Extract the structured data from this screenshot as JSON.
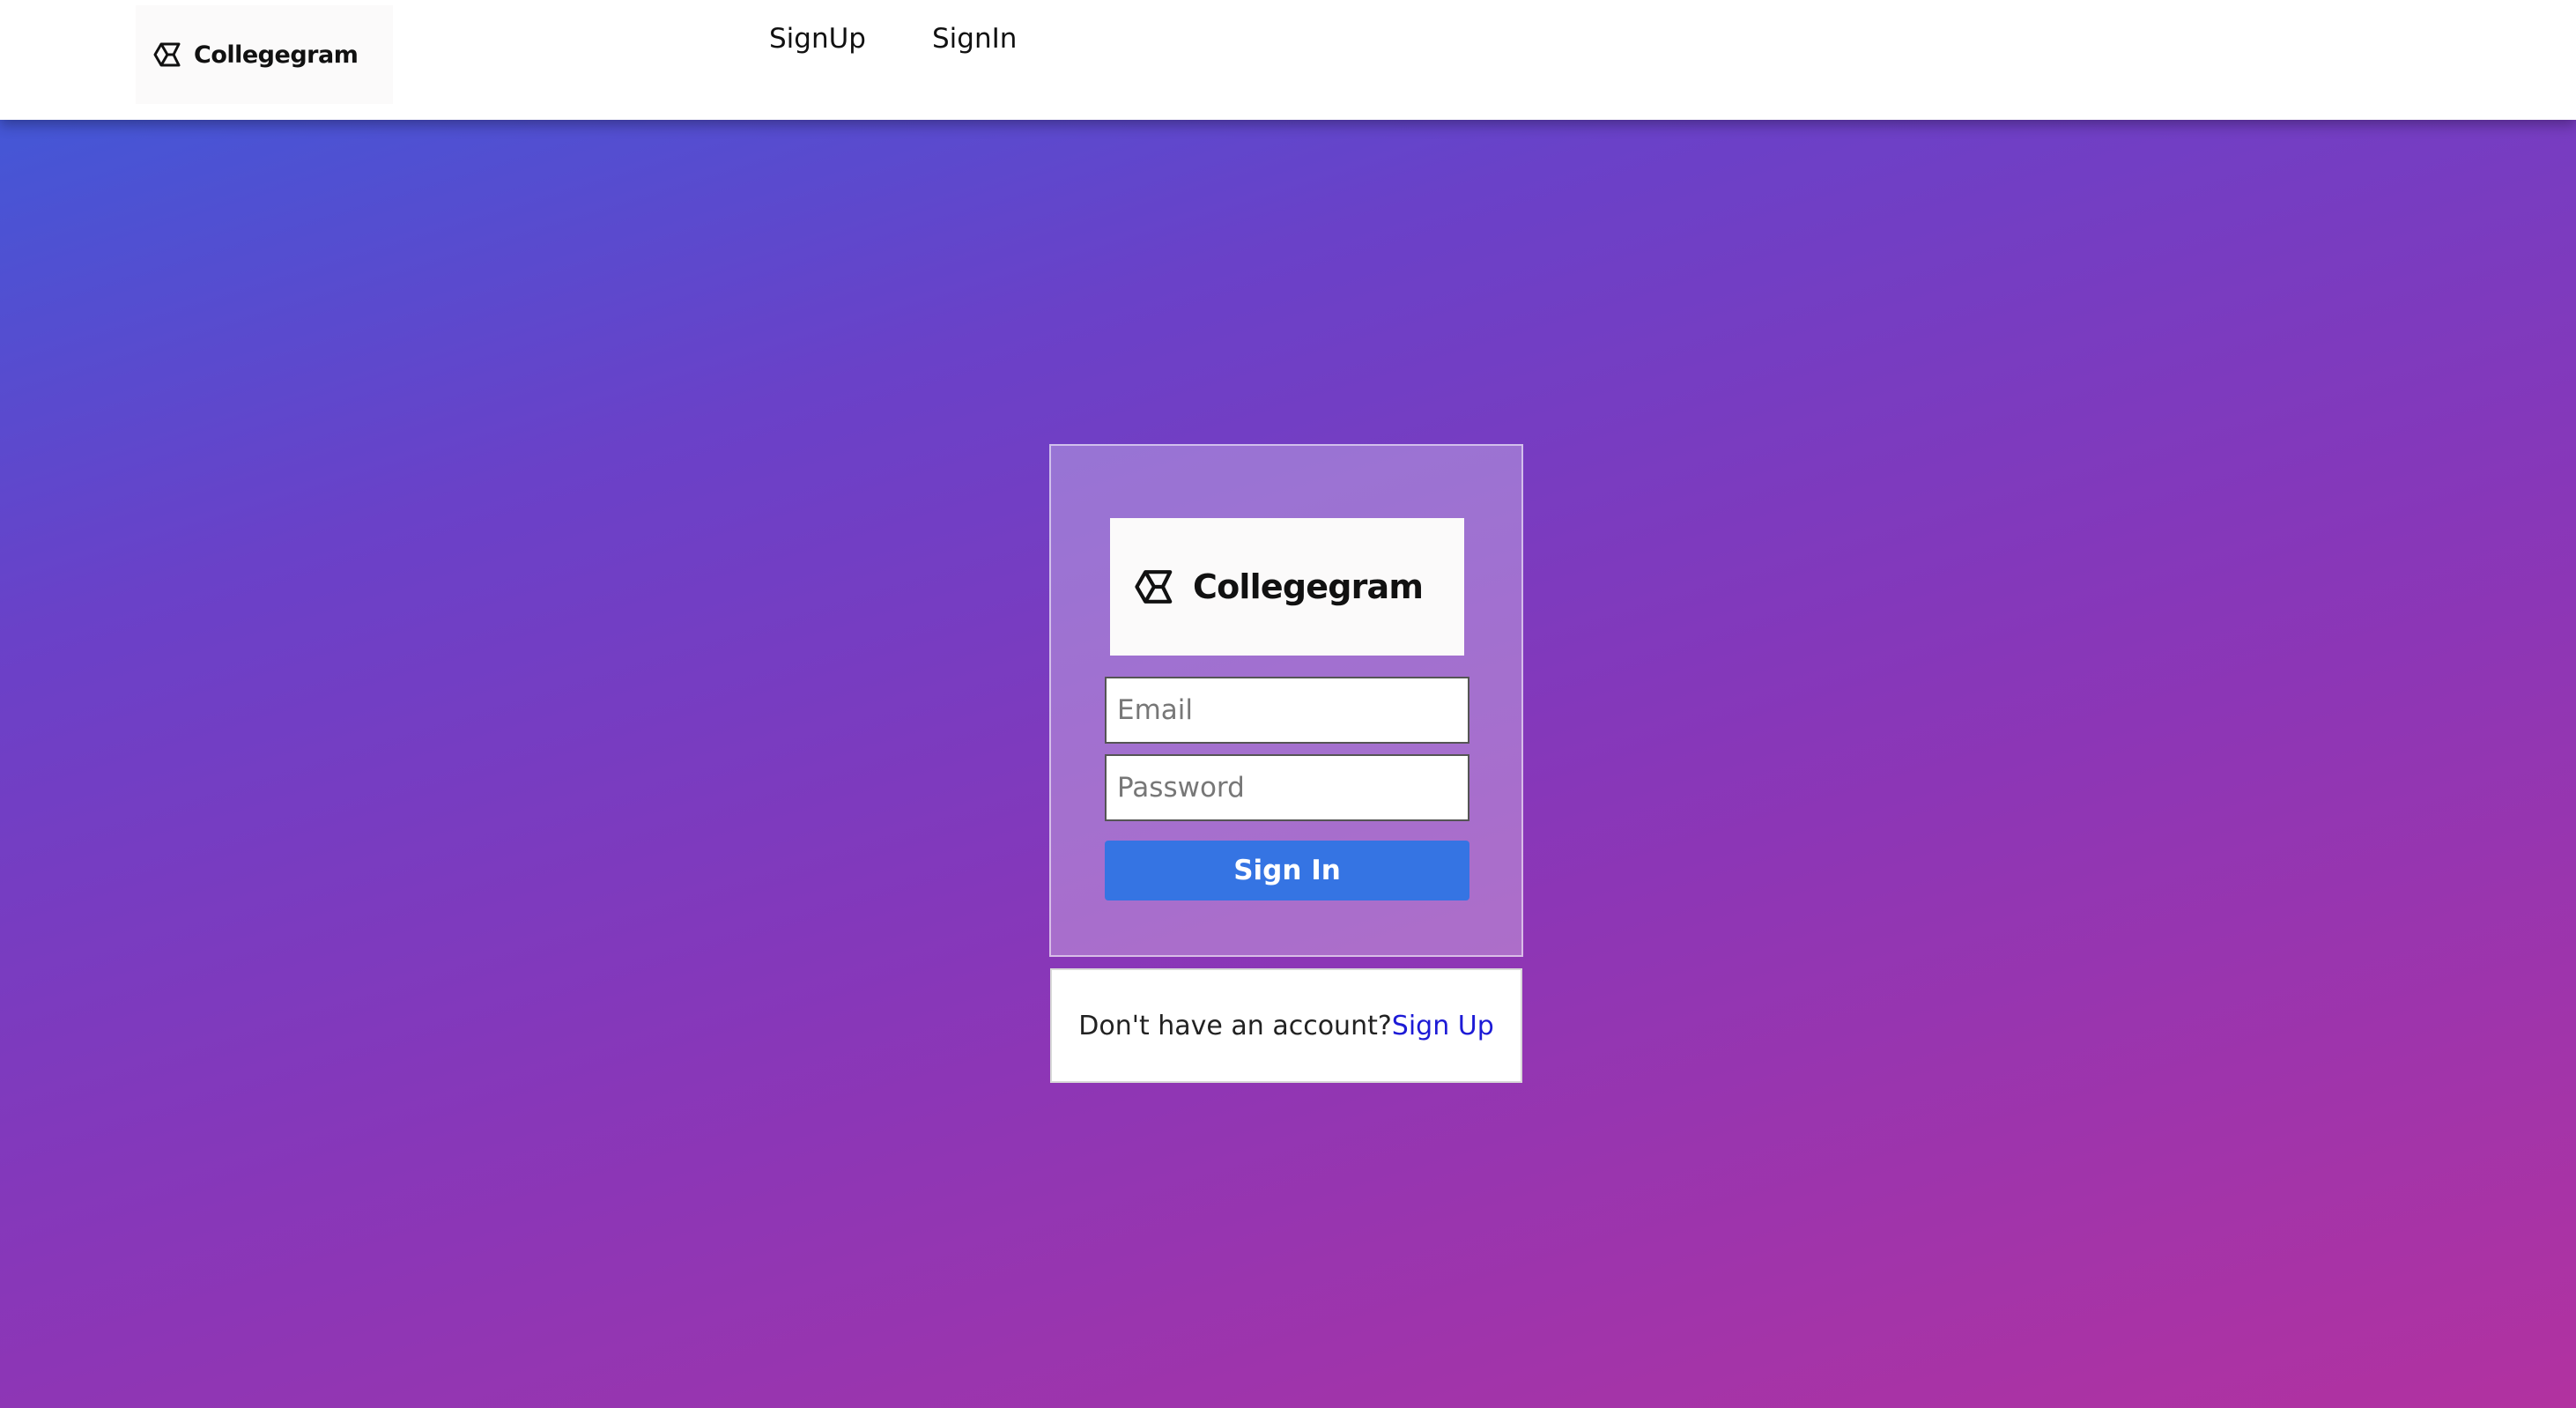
{
  "header": {
    "logo_text": "Collegegram",
    "nav": {
      "signup_label": "SignUp",
      "signin_label": "SignIn"
    }
  },
  "login_card": {
    "logo_text": "Collegegram",
    "email_placeholder": "Email",
    "password_placeholder": "Password",
    "signin_button_label": "Sign In"
  },
  "signup_prompt": {
    "text": "Don't have an account?",
    "link_label": "Sign Up"
  },
  "colors": {
    "button": "#3574e3",
    "link": "#1d1bd6",
    "gradient_start": "#4457d6",
    "gradient_end": "#b232a0"
  },
  "icons": {
    "logo": "collegegram-cube-icon"
  }
}
